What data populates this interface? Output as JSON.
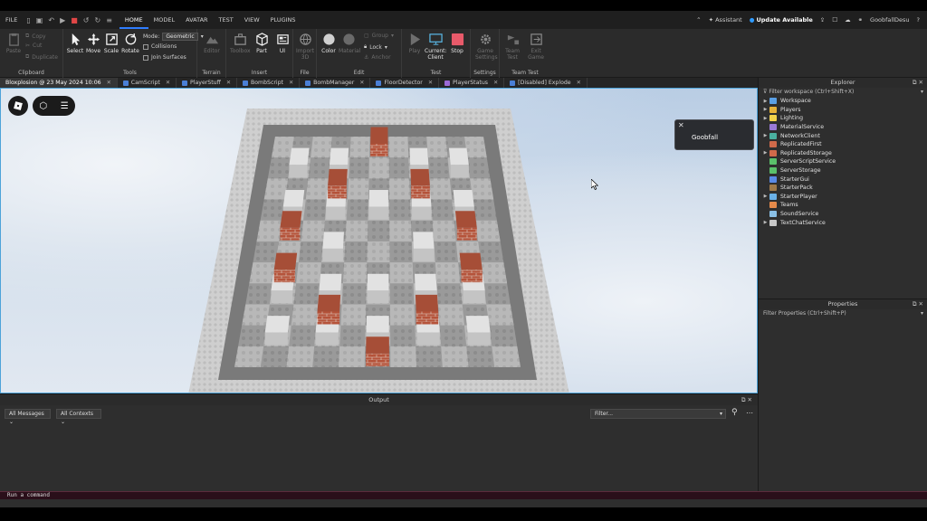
{
  "menu": {
    "file": "FILE",
    "tabs": [
      "HOME",
      "MODEL",
      "AVATAR",
      "TEST",
      "VIEW",
      "PLUGINS"
    ],
    "assistant": "Assistant",
    "update": "Update Available",
    "user": "GoobfallDesu"
  },
  "ribbon": {
    "clipboard": {
      "label": "Clipboard",
      "paste": "Paste",
      "copy": "Copy",
      "cut": "Cut",
      "duplicate": "Duplicate"
    },
    "tools": {
      "label": "Tools",
      "select": "Select",
      "move": "Move",
      "scale": "Scale",
      "rotate": "Rotate",
      "mode_label": "Mode:",
      "mode_value": "Geometric",
      "collisions": "Collisions",
      "join_surfaces": "Join Surfaces"
    },
    "terrain": {
      "label": "Terrain",
      "editor": "Editor"
    },
    "insert": {
      "label": "Insert",
      "toolbox": "Toolbox",
      "part": "Part",
      "ui": "UI"
    },
    "file": {
      "label": "File",
      "import": "Import 3D"
    },
    "edit": {
      "label": "Edit",
      "color": "Color",
      "material": "Material",
      "group": "Group",
      "lock": "Lock",
      "anchor": "Anchor"
    },
    "test": {
      "label": "Test",
      "play": "Play",
      "current": "Current: Client",
      "stop": "Stop"
    },
    "settings": {
      "label": "Settings",
      "game_settings": "Game Settings"
    },
    "team_test": {
      "label": "Team Test",
      "team_test": "Team Test",
      "exit_game": "Exit Game"
    }
  },
  "doc_tabs": [
    {
      "label": "Bloxplosion @ 23 May 2024 10:06",
      "color": "#3a3a3a"
    },
    {
      "label": "CamScript",
      "color": "#4a7fd6"
    },
    {
      "label": "PlayerStuff",
      "color": "#4a7fd6"
    },
    {
      "label": "BombScript",
      "color": "#4a7fd6"
    },
    {
      "label": "BombManager",
      "color": "#4a7fd6"
    },
    {
      "label": "FloorDetector",
      "color": "#4a7fd6"
    },
    {
      "label": "PlayerStatus",
      "color": "#9a6ad6"
    },
    {
      "label": "[Disabled] Explode",
      "color": "#4a7fd6"
    }
  ],
  "toast": {
    "text": "Goobfall"
  },
  "output": {
    "title": "Output",
    "messages": "All Messages",
    "contexts": "All Contexts",
    "filter_placeholder": "Filter..."
  },
  "command": {
    "placeholder": "Run a command"
  },
  "explorer": {
    "title": "Explorer",
    "filter": "Filter workspace (Ctrl+Shift+X)",
    "items": [
      {
        "name": "Workspace",
        "color": "#5aa0e6",
        "expand": true
      },
      {
        "name": "Players",
        "color": "#e6b33a",
        "expand": true
      },
      {
        "name": "Lighting",
        "color": "#f2d24a",
        "expand": true
      },
      {
        "name": "MaterialService",
        "color": "#9a7ad6",
        "expand": false
      },
      {
        "name": "NetworkClient",
        "color": "#4ab0a0",
        "expand": true
      },
      {
        "name": "ReplicatedFirst",
        "color": "#d06a4a",
        "expand": false
      },
      {
        "name": "ReplicatedStorage",
        "color": "#d06a4a",
        "expand": true
      },
      {
        "name": "ServerScriptService",
        "color": "#5ac06a",
        "expand": false
      },
      {
        "name": "ServerStorage",
        "color": "#5ac06a",
        "expand": false
      },
      {
        "name": "StarterGui",
        "color": "#5a8ae6",
        "expand": false
      },
      {
        "name": "StarterPack",
        "color": "#a07a4a",
        "expand": false
      },
      {
        "name": "StarterPlayer",
        "color": "#6ab0e6",
        "expand": true
      },
      {
        "name": "Teams",
        "color": "#e68a4a",
        "expand": false
      },
      {
        "name": "SoundService",
        "color": "#8ac0e6",
        "expand": false
      },
      {
        "name": "TextChatService",
        "color": "#c8c8c8",
        "expand": true
      }
    ]
  },
  "properties": {
    "title": "Properties",
    "filter": "Filter Properties (Ctrl+Shift+P)"
  }
}
